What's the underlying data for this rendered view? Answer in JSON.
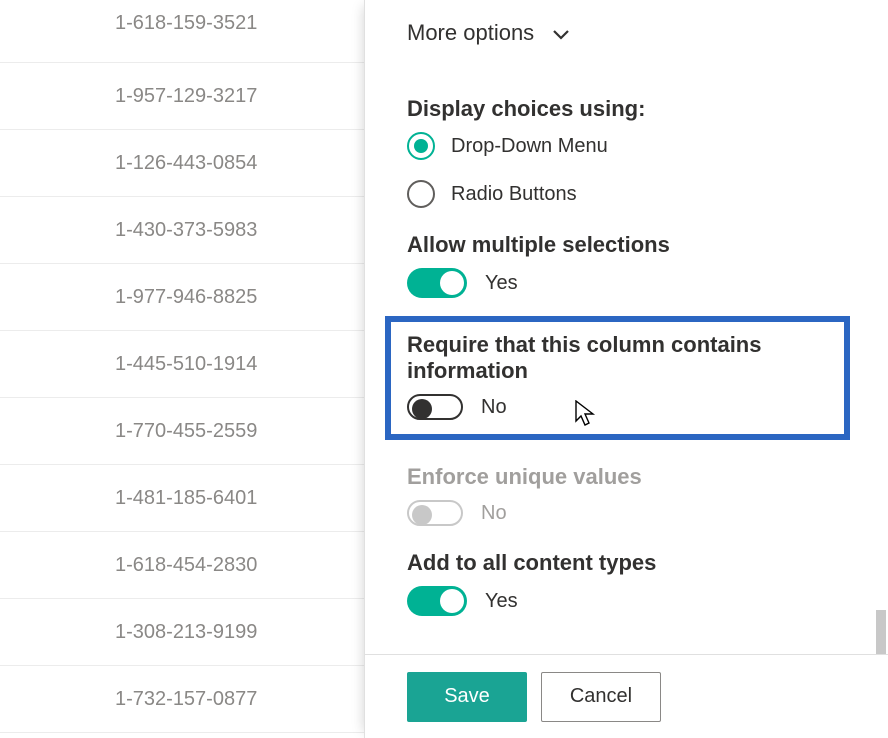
{
  "left_list": {
    "rows": [
      "1-618-159-3521",
      "1-957-129-3217",
      "1-126-443-0854",
      "1-430-373-5983",
      "1-977-946-8825",
      "1-445-510-1914",
      "1-770-455-2559",
      "1-481-185-6401",
      "1-618-454-2830",
      "1-308-213-9199",
      "1-732-157-0877"
    ]
  },
  "panel": {
    "more_options_label": "More options",
    "display_choices_label": "Display choices using:",
    "display_choices_options": {
      "dropdown": "Drop-Down Menu",
      "radio": "Radio Buttons"
    },
    "allow_multi_label": "Allow multiple selections",
    "allow_multi_value": "Yes",
    "require_info_label": "Require that this column contains information",
    "require_info_value": "No",
    "enforce_unique_label": "Enforce unique values",
    "enforce_unique_value": "No",
    "add_to_all_label": "Add to all content types",
    "add_to_all_value": "Yes"
  },
  "footer": {
    "save": "Save",
    "cancel": "Cancel"
  }
}
